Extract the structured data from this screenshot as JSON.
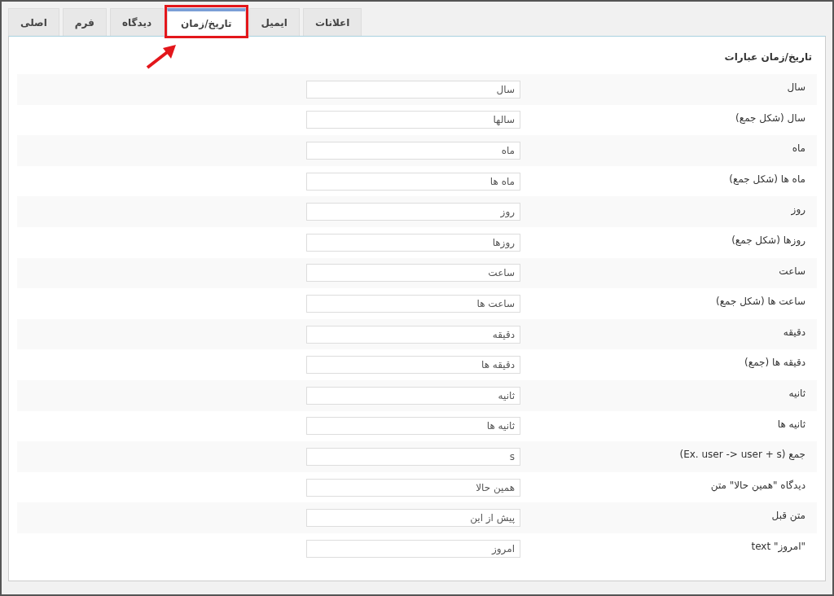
{
  "tabs": [
    {
      "label": "اعلانات",
      "selected": false
    },
    {
      "label": "ایمیل",
      "selected": false
    },
    {
      "label": "تاریخ/زمان",
      "selected": true
    },
    {
      "label": "دیدگاه",
      "selected": false
    },
    {
      "label": "فرم",
      "selected": false
    },
    {
      "label": "اصلی",
      "selected": false
    }
  ],
  "section_title": "تاریخ/زمان عبارات",
  "fields": [
    {
      "label": "سال",
      "value": "سال"
    },
    {
      "label": "سال (شکل جمع)",
      "value": "سالها"
    },
    {
      "label": "ماه",
      "value": "ماه"
    },
    {
      "label": "ماه ها (شکل جمع)",
      "value": "ماه ها"
    },
    {
      "label": "روز",
      "value": "روز"
    },
    {
      "label": "روزها (شکل جمع)",
      "value": "روزها"
    },
    {
      "label": "ساعت",
      "value": "ساعت"
    },
    {
      "label": "ساعت ها (شکل جمع)",
      "value": "ساعت ها"
    },
    {
      "label": "دقیقه",
      "value": "دقیقه"
    },
    {
      "label": "دقیقه ها (جمع)",
      "value": "دقیقه ها"
    },
    {
      "label": "ثانیه",
      "value": "ثانیه"
    },
    {
      "label": "ثانیه ها",
      "value": "ثانیه ها"
    },
    {
      "label": "جمع (Ex. user -> user + s)",
      "value": "s"
    },
    {
      "label": "دیدگاه \"همین حالا\" متن",
      "value": "همین حالا"
    },
    {
      "label": "متن قبل",
      "value": "پیش از این"
    },
    {
      "label": "\"امروز\" text",
      "value": "امروز"
    }
  ]
}
